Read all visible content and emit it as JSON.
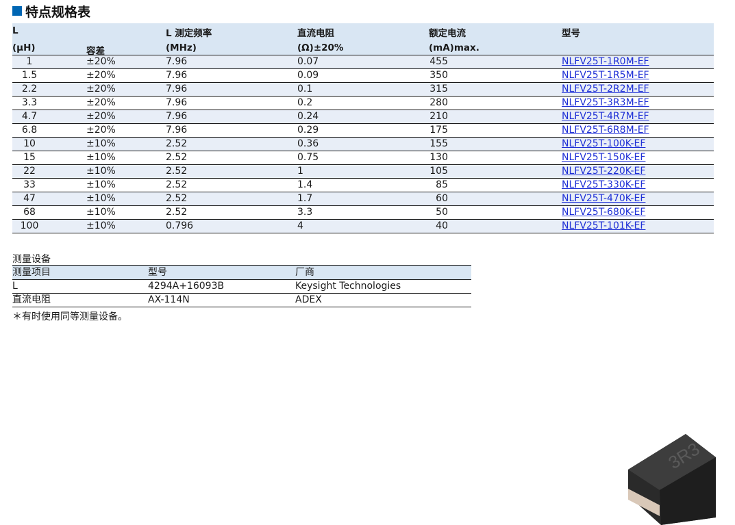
{
  "title": "特点规格表",
  "spec": {
    "headers": {
      "l_line1": "L",
      "l_line2": "(μH)",
      "tolerance": "容差",
      "freq_line1": "L 测定频率",
      "freq_line2": "(MHz)",
      "dcr_line1": "直流电阻",
      "dcr_line2": "(Ω)±20%",
      "current_line1": "额定电流",
      "current_line2": "(mA)max.",
      "part": "型号"
    },
    "rows": [
      {
        "l": "1",
        "tol": "±20%",
        "freq": "7.96",
        "dcr": "0.07",
        "current": "455",
        "part": "NLFV25T-1R0M-EF"
      },
      {
        "l": "1.5",
        "tol": "±20%",
        "freq": "7.96",
        "dcr": "0.09",
        "current": "350",
        "part": "NLFV25T-1R5M-EF"
      },
      {
        "l": "2.2",
        "tol": "±20%",
        "freq": "7.96",
        "dcr": "0.1",
        "current": "315",
        "part": "NLFV25T-2R2M-EF"
      },
      {
        "l": "3.3",
        "tol": "±20%",
        "freq": "7.96",
        "dcr": "0.2",
        "current": "280",
        "part": "NLFV25T-3R3M-EF"
      },
      {
        "l": "4.7",
        "tol": "±20%",
        "freq": "7.96",
        "dcr": "0.24",
        "current": "210",
        "part": "NLFV25T-4R7M-EF"
      },
      {
        "l": "6.8",
        "tol": "±20%",
        "freq": "7.96",
        "dcr": "0.29",
        "current": "175",
        "part": "NLFV25T-6R8M-EF"
      },
      {
        "l": "10",
        "tol": "±10%",
        "freq": "2.52",
        "dcr": "0.36",
        "current": "155",
        "part": "NLFV25T-100K-EF"
      },
      {
        "l": "15",
        "tol": "±10%",
        "freq": "2.52",
        "dcr": "0.75",
        "current": "130",
        "part": "NLFV25T-150K-EF"
      },
      {
        "l": "22",
        "tol": "±10%",
        "freq": "2.52",
        "dcr": "1",
        "current": "105",
        "part": "NLFV25T-220K-EF"
      },
      {
        "l": "33",
        "tol": "±10%",
        "freq": "2.52",
        "dcr": "1.4",
        "current": "85",
        "part": "NLFV25T-330K-EF"
      },
      {
        "l": "47",
        "tol": "±10%",
        "freq": "2.52",
        "dcr": "1.7",
        "current": "60",
        "part": "NLFV25T-470K-EF"
      },
      {
        "l": "68",
        "tol": "±10%",
        "freq": "2.52",
        "dcr": "3.3",
        "current": "50",
        "part": "NLFV25T-680K-EF"
      },
      {
        "l": "100",
        "tol": "±10%",
        "freq": "0.796",
        "dcr": "4",
        "current": "40",
        "part": "NLFV25T-101K-EF"
      }
    ]
  },
  "measurement": {
    "title": "测量设备",
    "headers": {
      "item": "测量项目",
      "model": "型号",
      "maker": "厂商"
    },
    "rows": [
      {
        "item": "L",
        "model": "4294A+16093B",
        "maker": "Keysight Technologies"
      },
      {
        "item": "直流电阻",
        "model": "AX-114N",
        "maker": "ADEX"
      }
    ],
    "note": "＊有时使用同等测量设备。"
  },
  "product": {
    "marking": "3R3"
  },
  "colors": {
    "accent": "#0066b3",
    "header_bg": "#d9e6f3",
    "row_alt": "#e8eef7",
    "link": "#1e2fd6"
  }
}
